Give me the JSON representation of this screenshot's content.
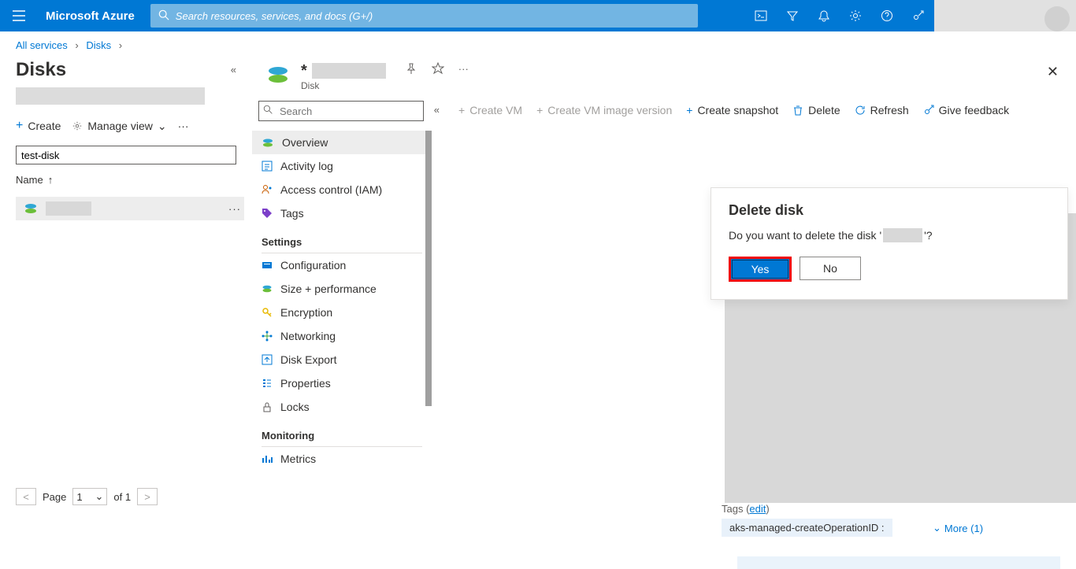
{
  "brand": "Microsoft Azure",
  "search_placeholder": "Search resources, services, and docs (G+/)",
  "breadcrumb": {
    "all_services": "All services",
    "disks": "Disks"
  },
  "left": {
    "title": "Disks",
    "create": "Create",
    "manage_view": "Manage view",
    "filter_value": "test-disk",
    "col_name": "Name",
    "page_label": "Page",
    "page_num": "1",
    "page_of": "of 1"
  },
  "resource": {
    "subtitle": "Disk",
    "nav_search_placeholder": "Search",
    "nav": {
      "overview": "Overview",
      "activity": "Activity log",
      "iam": "Access control (IAM)",
      "tags": "Tags",
      "settings": "Settings",
      "configuration": "Configuration",
      "size": "Size + performance",
      "encryption": "Encryption",
      "networking": "Networking",
      "export": "Disk Export",
      "properties": "Properties",
      "locks": "Locks",
      "monitoring": "Monitoring",
      "metrics": "Metrics"
    },
    "toolbar": {
      "create_vm": "Create VM",
      "create_image": "Create VM image version",
      "snapshot": "Create snapshot",
      "delete": "Delete",
      "refresh": "Refresh",
      "feedback": "Give feedback"
    }
  },
  "dialog": {
    "title": "Delete disk",
    "prefix": "Do you want to delete the disk '",
    "suffix": "'?",
    "yes": "Yes",
    "no": "No"
  },
  "tags": {
    "label": "Tags",
    "edit": "edit",
    "pill": "aks-managed-createOperationID :",
    "more": "More (1)"
  }
}
